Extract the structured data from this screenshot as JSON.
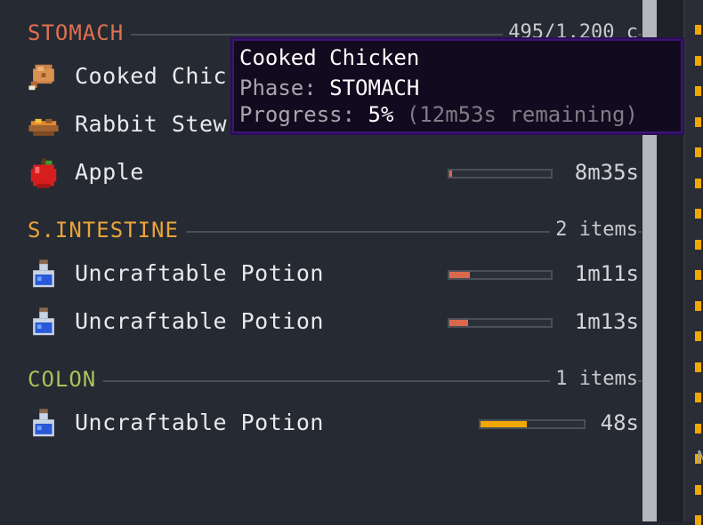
{
  "sections": {
    "stomach": {
      "title": "STOMACH",
      "count": "495/1,200 c",
      "color": "#e0704f"
    },
    "small_intestine": {
      "title": "S.INTESTINE",
      "count": "2 items",
      "color": "#e9a43a"
    },
    "colon": {
      "title": "COLON",
      "count": "1 items",
      "color": "#a6c45a"
    }
  },
  "stomach_items": [
    {
      "name": "Cooked Chic",
      "time": "12m53s",
      "icon": "cooked-chicken-icon",
      "progress": 0.05,
      "bar_color": "#d9694a"
    },
    {
      "name": "Rabbit Stew",
      "time": "",
      "icon": "rabbit-stew-icon",
      "progress": 0.0,
      "bar_color": "#d9694a"
    },
    {
      "name": "Apple",
      "time": "8m35s",
      "icon": "apple-icon",
      "progress": 0.02,
      "bar_color": "#d9694a"
    }
  ],
  "intestine_items": [
    {
      "name": "Uncraftable Potion",
      "time": "1m11s",
      "icon": "potion-icon",
      "progress": 0.2,
      "bar_color": "#d9694a"
    },
    {
      "name": "Uncraftable Potion",
      "time": "1m13s",
      "icon": "potion-icon",
      "progress": 0.18,
      "bar_color": "#d9694a"
    }
  ],
  "colon_items": [
    {
      "name": "Uncraftable Potion",
      "time": "48s",
      "icon": "potion-icon",
      "progress": 0.45,
      "bar_color": "#f0a800"
    }
  ],
  "tooltip": {
    "title": "Cooked Chicken",
    "phase_label": "Phase: ",
    "phase_value": "STOMACH",
    "progress_label": "Progress: ",
    "progress_value": "5%",
    "remaining": " (12m53s remaining)"
  },
  "side_letter": "N"
}
